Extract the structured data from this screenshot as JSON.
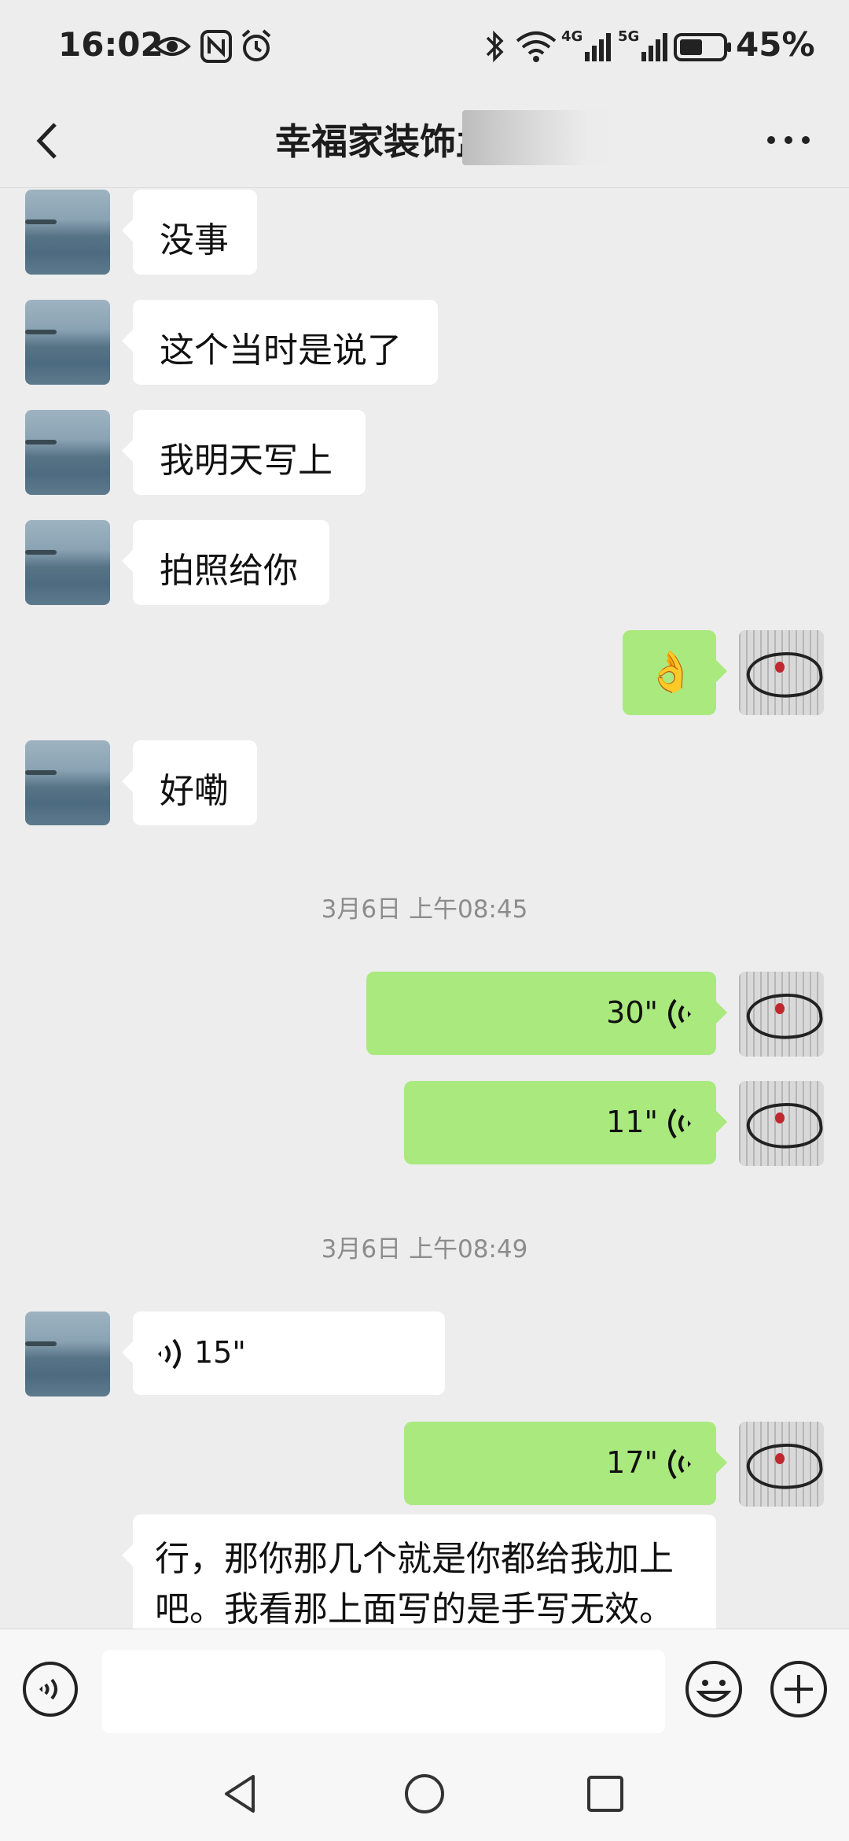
{
  "status_bar": {
    "time": "16:02",
    "battery": "45%"
  },
  "header": {
    "title": "幸福家装饰孟",
    "back_icon": "chevron-left-icon",
    "more_icon": "more-dots-icon"
  },
  "messages": {
    "m1": "没事",
    "m2": "这个当时是说了",
    "m3": "我明天写上",
    "m4": "拍照给你",
    "m5_emoji": "👌",
    "m6": "好嘞",
    "ts1": "3月6日 上午08:45",
    "v1": "30\"",
    "v2": "11\"",
    "ts2": "3月6日 上午08:49",
    "v3": "15\"",
    "v4": "17\"",
    "long_line1": "行，那你那几个就是你都给我加上",
    "long_line2": "吧。我看那上面写的是手写无效。"
  },
  "input_bar": {
    "placeholder": "",
    "voice_icon": "voice-toggle-icon",
    "emoji_icon": "emoji-icon",
    "plus_icon": "plus-icon"
  },
  "nav": {
    "back": "nav-back-icon",
    "home": "nav-home-icon",
    "recent": "nav-recent-icon"
  },
  "colors": {
    "outgoing_bubble": "#a9e97d",
    "incoming_bubble": "#ffffff",
    "background": "#ededed"
  }
}
